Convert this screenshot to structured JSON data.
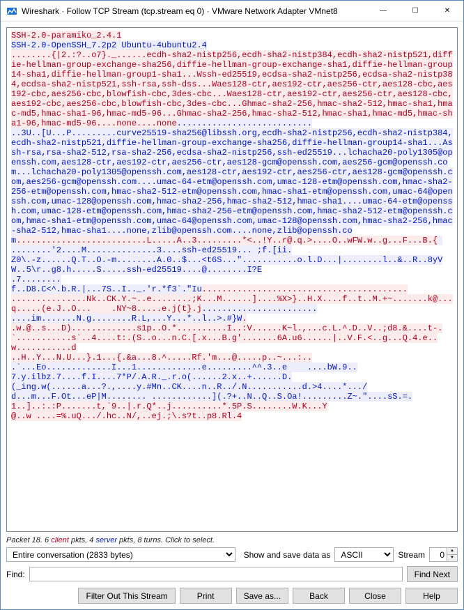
{
  "window": {
    "title": "Wireshark · Follow TCP Stream (tcp.stream eq 0) · VMware Network Adapter VMnet8"
  },
  "titlebar_buttons": {
    "minimize": "—",
    "maximize": "☐",
    "close": "✕"
  },
  "stream": {
    "segments": [
      {
        "cls": "red",
        "t": "SSH-2.0-paramiko_2.4.1\n"
      },
      {
        "cls": "blue",
        "t": "SSH-2.0-OpenSSH_7.2p2 Ubuntu-4ubuntu2.4\n"
      },
      {
        "cls": "red",
        "t": "........{|2.:?..o7}._......ecdh-sha2-nistp256,ecdh-sha2-nistp384,ecdh-sha2-nistp521,diffie-hellman-group-exchange-sha256,diffie-hellman-group-exchange-sha1,diffie-hellman-group14-sha1,diffie-hellman-group1-sha1...Wssh-ed25519,ecdsa-sha2-nistp256,ecdsa-sha2-nistp384,ecdsa-sha2-nistp521,ssh-rsa,ssh-dss...Waes128-ctr,aes192-ctr,aes256-ctr,aes128-cbc,aes192-cbc,aes256-cbc,blowfish-cbc,3des-cbc...Waes128-ctr,aes192-ctr,aes256-ctr,aes128-cbc,aes192-cbc,aes256-cbc,blowfish-cbc,3des-cbc...Ghmac-sha2-256,hmac-sha2-512,hmac-sha1,hmac-md5,hmac-sha1-96,hmac-md5-96...Ghmac-sha2-256,hmac-sha2-512,hmac-sha1,hmac-md5,hmac-sha1-96,hmac-md5-96....none....none"
      },
      {
        "cls": "blue",
        "t": "...........................\n..3U..[U...P.........curve25519-sha256@libssh.org,ecdh-sha2-nistp256,ecdh-sha2-nistp384,ecdh-sha2-nistp521,diffie-hellman-group-exchange-sha256,diffie-hellman-group14-sha1...Assh-rsa,rsa-sha2-512,rsa-sha2-256,ecdsa-sha2-nistp256,ssh-ed25519...lchacha20-poly1305@openssh.com,aes128-ctr,aes192-ctr,aes256-ctr,aes128-gcm@openssh.com,aes256-gcm@openssh.com...lchacha20-poly1305@openssh.com,aes128-ctr,aes192-ctr,aes256-ctr,aes128-gcm@openssh.com,aes256-gcm@openssh.com....umac-64-etm@openssh.com,umac-128-etm@openssh.com,hmac-sha2-256-etm@openssh.com,hmac-sha2-512-etm@openssh.com,hmac-sha1-etm@openssh.com,umac-64@openssh.com,umac-128@openssh.com,hmac-sha2-256,hmac-sha2-512,hmac-sha1....umac-64-etm@openssh.com,umac-128-etm@openssh.com,hmac-sha2-256-etm@openssh.com,hmac-sha2-512-etm@openssh.com,hmac-sha1-etm@openssh.com,umac-64@openssh.com,umac-128@openssh.com,hmac-sha2-256,hmac-sha2-512,hmac-sha1....none,zlib@openssh.com....none,zlib@openssh.com"
      },
      {
        "cls": "red",
        "t": "..........................L.....A..3.........*<..!Y..r@.q.>....O..wFW.w..g...F...B.{"
      },
      {
        "cls": "blue",
        "t": " ........'2....M..............3....ssh-ed25519... ;f.[ii.\nZ0\\.-z......Q.T..O.-m........A.0..$...<t6S...\"...........o.l.D...|........l..&..R..8yVW..5\\r..g8.h.....S.....ssh-ed25519....@........I?E\n.7........\nf..D8.C<^.b.R.|...7S..I.._.'r.*f3`.\"Iu"
      },
      {
        "cls": "red",
        "t": ".........................................\n...............Nk..CK.Y.~..e........;K...M......]....%X>}..H.X....f..t..M.+~.......k@...q.....(e.J..O...    .NY~8.....e.j(t}.j"
      },
      {
        "cls": "blue",
        "t": ".......................\n....im.......N.g........R.L,...Y...*..l..>.#}W"
      },
      {
        "cls": "red",
        "t": ".\n.w.@..s...D).............s1p..O.*..........I..:V......K~l.,...c.L.^.D..V..;d8.&....t-.`...........s`..4....t:.(S..o...n.C.[.x...B.g'.......6A.u6......|..V.F.<..g...Q.4.e..w...........d\n..H..Y...N.U...}.1...{.&a...8.^.....Rf.'m...@.....p..~...:.."
      },
      {
        "cls": "blue",
        "t": "\n.`...Eo.............I...1.............e.........^^.3..e    ....bW.9..\n7.y.ilbz.7....f.I....7*P/.A.R._.r.o(......2.x..+......D.\n(_ing.w(......a...?.,....y.#Mn..CK....n..R../.N...........d.>4....*.../\nd...m...F.Ot...eP|M........ ............](.?+..N..Q..S.Oa!.........Z~.\"....sS.=."
      },
      {
        "cls": "red",
        "t": "\n1..]..:.:P.......t,`9..|.r.Q*..j..........*.5P.S........W.K...Y\n@..w ....=%.uQ.../.hc..N/,..ej.;\\.s?t..p8.Rl.4"
      }
    ]
  },
  "info": {
    "pre": "Packet 18. 6 ",
    "client": "client",
    "mid1": " pkts, 4 ",
    "server": "server",
    "mid2": " pkts, 8 turns. ",
    "tail": "Click to select."
  },
  "controls": {
    "conversation_select": "Entire conversation (2833 bytes)",
    "show_save_label": "Show and save data as",
    "mode_select": "ASCII",
    "stream_label": "Stream",
    "stream_value": "0"
  },
  "find": {
    "label": "Find:",
    "value": "",
    "button": "Find Next"
  },
  "buttons": {
    "filter": "Filter Out This Stream",
    "print": "Print",
    "save": "Save as...",
    "back": "Back",
    "close": "Close",
    "help": "Help"
  }
}
